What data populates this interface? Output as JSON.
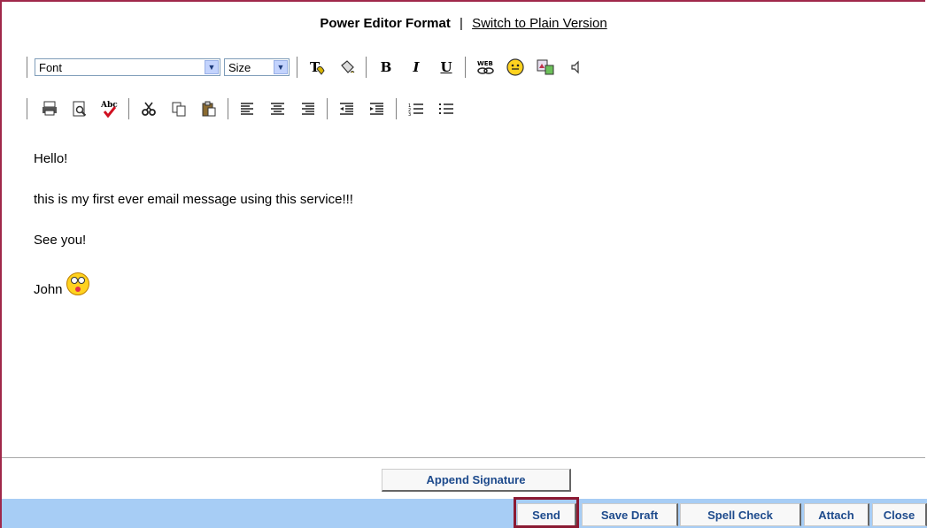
{
  "header": {
    "title": "Power Editor Format",
    "separator": "|",
    "switch_link": "Switch to Plain Version"
  },
  "toolbar": {
    "font_select": "Font",
    "size_select": "Size",
    "bold": "B",
    "italic": "I",
    "underline": "U"
  },
  "editor": {
    "lines": [
      "Hello!",
      "this is my first ever email message using this service!!!",
      "See you!",
      "John"
    ]
  },
  "buttons": {
    "append_signature": "Append Signature",
    "send": "Send",
    "save_draft": "Save Draft",
    "spell_check": "Spell Check",
    "attach": "Attach",
    "close": "Close"
  },
  "colors": {
    "bottom_bar": "#a7cdf5",
    "button_text": "#1d4a8c",
    "highlight": "#8b1a33"
  }
}
